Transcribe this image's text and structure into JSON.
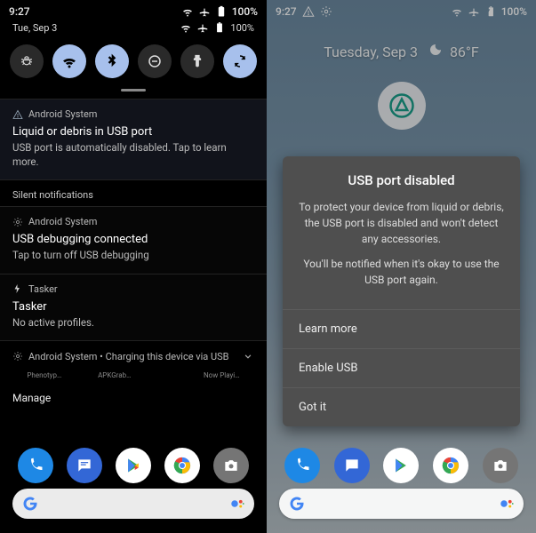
{
  "left": {
    "status": {
      "time": "9:27",
      "battery": "100%"
    },
    "date": "Tue, Sep 3",
    "qs": [
      {
        "name": "bug",
        "on": false
      },
      {
        "name": "wifi",
        "on": true
      },
      {
        "name": "bluetooth",
        "on": true
      },
      {
        "name": "dnd",
        "on": false
      },
      {
        "name": "flashlight",
        "on": false
      },
      {
        "name": "rotate",
        "on": true
      }
    ],
    "notif1": {
      "app": "Android System",
      "title": "Liquid or debris in USB port",
      "body": "USB port is automatically disabled. Tap to learn more."
    },
    "silent_header": "Silent notifications",
    "notif2": {
      "app": "Android System",
      "title": "USB debugging connected",
      "body": "Tap to turn off USB debugging"
    },
    "notif3": {
      "app": "Tasker",
      "title": "Tasker",
      "body": "No active profiles."
    },
    "collapsed": "Android System • Charging this device via USB",
    "manage": "Manage",
    "ghost": [
      "Phenotyp…",
      "APKGrab…",
      "",
      "Now Playi…"
    ]
  },
  "right": {
    "status": {
      "time": "9:27",
      "battery": "100%"
    },
    "date_line": "Tuesday, Sep 3",
    "temp": "86°F",
    "dialog": {
      "title": "USB port disabled",
      "p1": "To protect your device from liquid or debris, the USB port is disabled and won't detect any accessories.",
      "p2": "You'll be notified when it's okay to use the USB port again.",
      "actions": [
        "Learn more",
        "Enable USB",
        "Got it"
      ]
    }
  },
  "colors": {
    "phone": "#1e88e5",
    "messages": "#3367d6",
    "chrome_red": "#ea4335",
    "chrome_yellow": "#fbbc05",
    "chrome_green": "#34a853",
    "chrome_blue": "#4285f4",
    "camera": "#757575",
    "g_blue": "#4285f4",
    "g_red": "#ea4335",
    "g_yellow": "#fbbc05",
    "g_green": "#34a853",
    "assistant": "#4285f4"
  }
}
